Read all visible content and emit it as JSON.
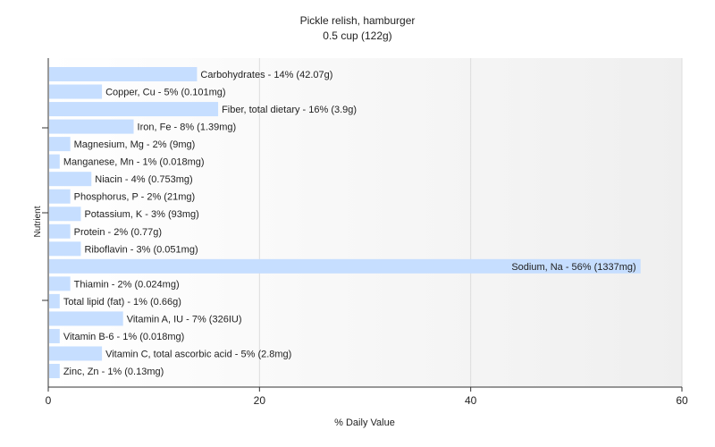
{
  "chart_data": {
    "type": "bar",
    "orientation": "horizontal",
    "title": "Pickle relish, hamburger",
    "subtitle": "0.5 cup (122g)",
    "xlabel": "% Daily Value",
    "ylabel": "Nutrient",
    "xlim": [
      0,
      60
    ],
    "xticks": [
      0,
      20,
      40,
      60
    ],
    "grid": true,
    "colors": {
      "bar": "#c6deff",
      "axis": "#333333",
      "grid": "#dddddd"
    },
    "categories": [
      "Carbohydrates",
      "Copper, Cu",
      "Fiber, total dietary",
      "Iron, Fe",
      "Magnesium, Mg",
      "Manganese, Mn",
      "Niacin",
      "Phosphorus, P",
      "Potassium, K",
      "Protein",
      "Riboflavin",
      "Sodium, Na",
      "Thiamin",
      "Total lipid (fat)",
      "Vitamin A, IU",
      "Vitamin B-6",
      "Vitamin C, total ascorbic acid",
      "Zinc, Zn"
    ],
    "values": [
      14,
      5,
      16,
      8,
      2,
      1,
      4,
      2,
      3,
      2,
      3,
      56,
      2,
      1,
      7,
      1,
      5,
      1
    ],
    "labels": [
      "Carbohydrates - 14% (42.07g)",
      "Copper, Cu - 5% (0.101mg)",
      "Fiber, total dietary - 16% (3.9g)",
      "Iron, Fe - 8% (1.39mg)",
      "Magnesium, Mg - 2% (9mg)",
      "Manganese, Mn - 1% (0.018mg)",
      "Niacin - 4% (0.753mg)",
      "Phosphorus, P - 2% (21mg)",
      "Potassium, K - 3% (93mg)",
      "Protein - 2% (0.77g)",
      "Riboflavin - 3% (0.051mg)",
      "Sodium, Na - 56% (1337mg)",
      "Thiamin - 2% (0.024mg)",
      "Total lipid (fat) - 1% (0.66g)",
      "Vitamin A, IU - 7% (326IU)",
      "Vitamin B-6 - 1% (0.018mg)",
      "Vitamin C, total ascorbic acid - 5% (2.8mg)",
      "Zinc, Zn - 1% (0.13mg)"
    ]
  }
}
